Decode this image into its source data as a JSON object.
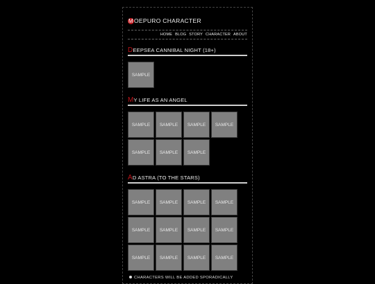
{
  "site": {
    "title_initial": "M",
    "title_rest": "OEPURO CHARACTER"
  },
  "nav": [
    "HOME",
    "BLOG",
    "STORY",
    "CHARACTER",
    "ABOUT"
  ],
  "sections": [
    {
      "initial": "D",
      "rest": "EEPSEA CANNIBAL NIGHT (18+)",
      "items": [
        "SAMPLE"
      ]
    },
    {
      "initial": "M",
      "rest": "Y LIFE AS AN ANGEL",
      "items": [
        "SAMPLE",
        "SAMPLE",
        "SAMPLE",
        "SAMPLE",
        "SAMPLE",
        "SAMPLE",
        "SAMPLE"
      ]
    },
    {
      "initial": "A",
      "rest": "D ASTRA (TO THE STARS)",
      "items": [
        "SAMPLE",
        "SAMPLE",
        "SAMPLE",
        "SAMPLE",
        "SAMPLE",
        "SAMPLE",
        "SAMPLE",
        "SAMPLE",
        "SAMPLE",
        "SAMPLE",
        "SAMPLE",
        "SAMPLE"
      ]
    }
  ],
  "footer": {
    "note": "CHARACTERS WILL BE ADDED SPORADICALLY"
  },
  "colors": {
    "accent": "#c0161c",
    "thumb": "#808080",
    "background": "#000000"
  }
}
